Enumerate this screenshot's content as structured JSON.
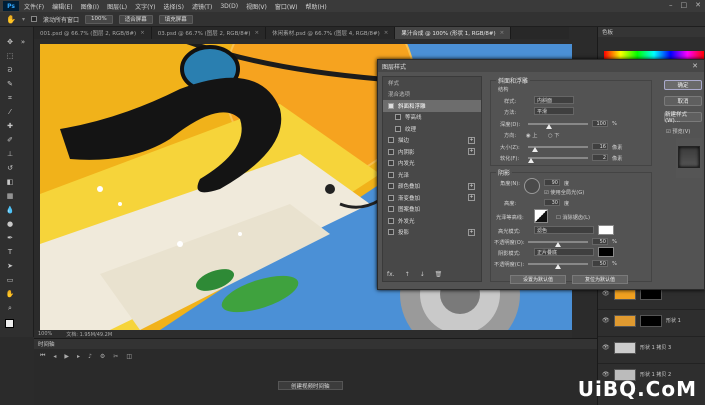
{
  "menubar": {
    "logo": "Ps",
    "items": [
      "文件(F)",
      "编辑(E)",
      "图像(I)",
      "图层(L)",
      "文字(Y)",
      "选择(S)",
      "滤镜(T)",
      "3D(D)",
      "视图(V)",
      "窗口(W)",
      "帮助(H)"
    ],
    "window_controls": [
      "–",
      "□",
      "✕"
    ]
  },
  "optbar": {
    "checkbox_label": "滚动所有窗口",
    "zoom_value": "100%",
    "fit_screen": "适合屏幕",
    "fill_screen": "填充屏幕"
  },
  "tabs": [
    {
      "label": "001.psd @ 66.7% (图层 2, RGB/8#)",
      "active": false
    },
    {
      "label": "03.psd @ 66.7% (图层 2, RGB/8#)",
      "active": false
    },
    {
      "label": "休闲素材.psd @ 66.7% (图层 4, RGB/8#)",
      "active": false
    },
    {
      "label": "果汁合成 @ 100% (形状 1, RGB/8#)",
      "active": true
    }
  ],
  "status": {
    "zoom": "100%",
    "doc": "文档: 1.95M/49.2M"
  },
  "timeline": {
    "title": "时间轴",
    "create_button": "创建视频时间轴"
  },
  "right_panel": {
    "swatches_title": "色板",
    "layers": [
      {
        "name": "形状 1",
        "visible": true
      },
      {
        "name": "形状 1 拷贝 3",
        "visible": true
      },
      {
        "name": "形状 1 拷贝 2",
        "visible": true
      }
    ]
  },
  "dialog": {
    "title": "图层样式",
    "styles": [
      {
        "label": "样式",
        "type": "hdr"
      },
      {
        "label": "混合选项",
        "type": "hdr"
      },
      {
        "label": "斜面和浮雕",
        "checked": true,
        "selected": true
      },
      {
        "label": "等高线",
        "checked": false,
        "indent": true
      },
      {
        "label": "纹理",
        "checked": false,
        "indent": true
      },
      {
        "label": "描边",
        "checked": false,
        "plus": true
      },
      {
        "label": "内阴影",
        "checked": false,
        "plus": true
      },
      {
        "label": "内发光",
        "checked": false
      },
      {
        "label": "光泽",
        "checked": false
      },
      {
        "label": "颜色叠加",
        "checked": false,
        "plus": true
      },
      {
        "label": "渐变叠加",
        "checked": false,
        "plus": true
      },
      {
        "label": "图案叠加",
        "checked": false
      },
      {
        "label": "外发光",
        "checked": false
      },
      {
        "label": "投影",
        "checked": false,
        "plus": true
      }
    ],
    "footer": [
      "fx.",
      "↑",
      "↓",
      "🗑"
    ],
    "bevel": {
      "group_title": "斜面和浮雕",
      "structure_title": "结构",
      "style_label": "样式:",
      "style_value": "内斜面",
      "technique_label": "方法:",
      "technique_value": "平滑",
      "depth_label": "深度(D):",
      "depth_value": "100",
      "depth_pct": 0.35,
      "direction_label": "方向:",
      "dir_up": "上",
      "dir_down": "下",
      "size_label": "大小(Z):",
      "size_value": "16",
      "size_pct": 0.12,
      "soften_label": "软化(F):",
      "soften_value": "2",
      "soften_pct": 0.05,
      "px": "像素",
      "pct": "%"
    },
    "shading": {
      "title": "阴影",
      "angle_label": "角度(N):",
      "angle_value": "90",
      "deg": "度",
      "global_light": "使用全局光(G)",
      "altitude_label": "高度:",
      "altitude_value": "30",
      "gloss_label": "光泽等高线:",
      "antialias": "消除锯齿(L)",
      "highlight_label": "高光模式:",
      "highlight_value": "滤色",
      "opacity1_label": "不透明度(O):",
      "opacity1_value": "50",
      "shadow_label": "阴影模式:",
      "shadow_value": "正片叠底",
      "opacity2_label": "不透明度(C):",
      "opacity2_value": "50",
      "make_default": "设置为默认值",
      "reset_default": "复位为默认值"
    },
    "actions": {
      "ok": "确定",
      "cancel": "取消",
      "new_style": "新建样式(W)...",
      "preview": "预览(V)"
    }
  },
  "watermark": "UiBQ.CoM"
}
